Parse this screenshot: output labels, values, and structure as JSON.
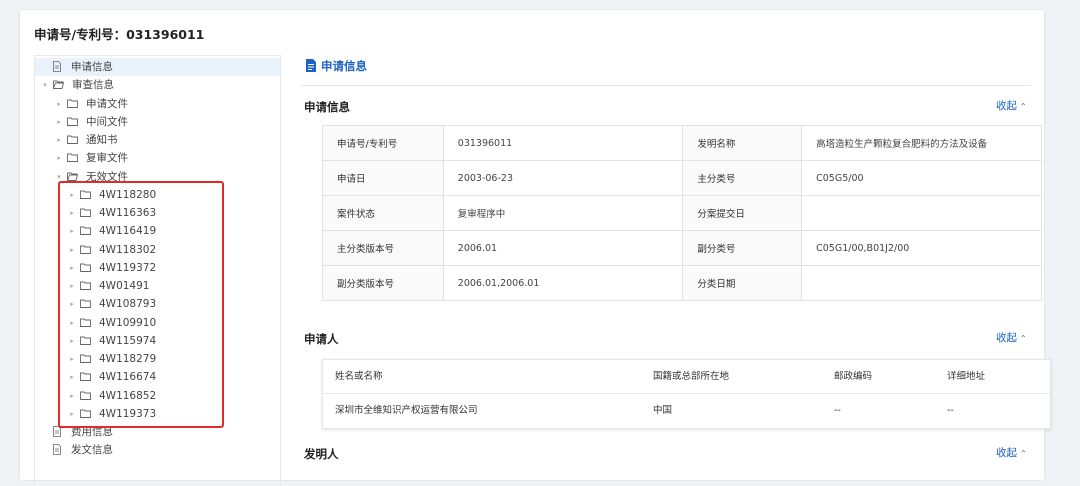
{
  "page_title": "申请号/专利号：",
  "page_title_number": "031396011",
  "tree": {
    "items": [
      {
        "label": "申请信息",
        "type": "doc",
        "level": 0,
        "selected": true
      },
      {
        "label": "审查信息",
        "type": "folder",
        "level": 0,
        "expanded": true
      },
      {
        "label": "申请文件",
        "type": "folder",
        "level": 1
      },
      {
        "label": "中间文件",
        "type": "folder",
        "level": 1
      },
      {
        "label": "通知书",
        "type": "folder",
        "level": 1
      },
      {
        "label": "复审文件",
        "type": "folder",
        "level": 1
      },
      {
        "label": "无效文件",
        "type": "folder",
        "level": 1,
        "expanded": true
      },
      {
        "label": "4W118280",
        "type": "folder",
        "level": 2
      },
      {
        "label": "4W116363",
        "type": "folder",
        "level": 2
      },
      {
        "label": "4W116419",
        "type": "folder",
        "level": 2
      },
      {
        "label": "4W118302",
        "type": "folder",
        "level": 2
      },
      {
        "label": "4W119372",
        "type": "folder",
        "level": 2
      },
      {
        "label": "4W01491",
        "type": "folder",
        "level": 2
      },
      {
        "label": "4W108793",
        "type": "folder",
        "level": 2
      },
      {
        "label": "4W109910",
        "type": "folder",
        "level": 2
      },
      {
        "label": "4W115974",
        "type": "folder",
        "level": 2
      },
      {
        "label": "4W118279",
        "type": "folder",
        "level": 2
      },
      {
        "label": "4W116674",
        "type": "folder",
        "level": 2
      },
      {
        "label": "4W116852",
        "type": "folder",
        "level": 2
      },
      {
        "label": "4W119373",
        "type": "folder",
        "level": 2
      },
      {
        "label": "费用信息",
        "type": "doc",
        "level": 0
      },
      {
        "label": "发文信息",
        "type": "doc",
        "level": 0
      }
    ]
  },
  "right": {
    "header": "申请信息",
    "sections": {
      "application": {
        "title": "申请信息",
        "collapse": "收起"
      },
      "applicant": {
        "title": "申请人",
        "collapse": "收起"
      },
      "inventor": {
        "title": "发明人",
        "collapse": "收起"
      }
    },
    "info_table": {
      "rows": [
        [
          "申请号/专利号",
          "031396011",
          "发明名称",
          "高塔造粒生产颗粒复合肥料的方法及设备"
        ],
        [
          "申请日",
          "2003-06-23",
          "主分类号",
          "C05G5/00"
        ],
        [
          "案件状态",
          "复审程序中",
          "分案提交日",
          ""
        ],
        [
          "主分类版本号",
          "2006.01",
          "副分类号",
          "C05G1/00,B01J2/00"
        ],
        [
          "副分类版本号",
          "2006.01,2006.01",
          "分类日期",
          ""
        ]
      ]
    },
    "applicant_table": {
      "headers": [
        "姓名或名称",
        "国籍或总部所在地",
        "邮政编码",
        "详细地址"
      ],
      "rows": [
        [
          "深圳市全维知识产权运营有限公司",
          "中国",
          "--",
          "--"
        ]
      ]
    }
  },
  "colors": {
    "accent": "#1e63c4",
    "highlight_box": "#e02b2b",
    "selected_bg": "#eaf2fb"
  }
}
